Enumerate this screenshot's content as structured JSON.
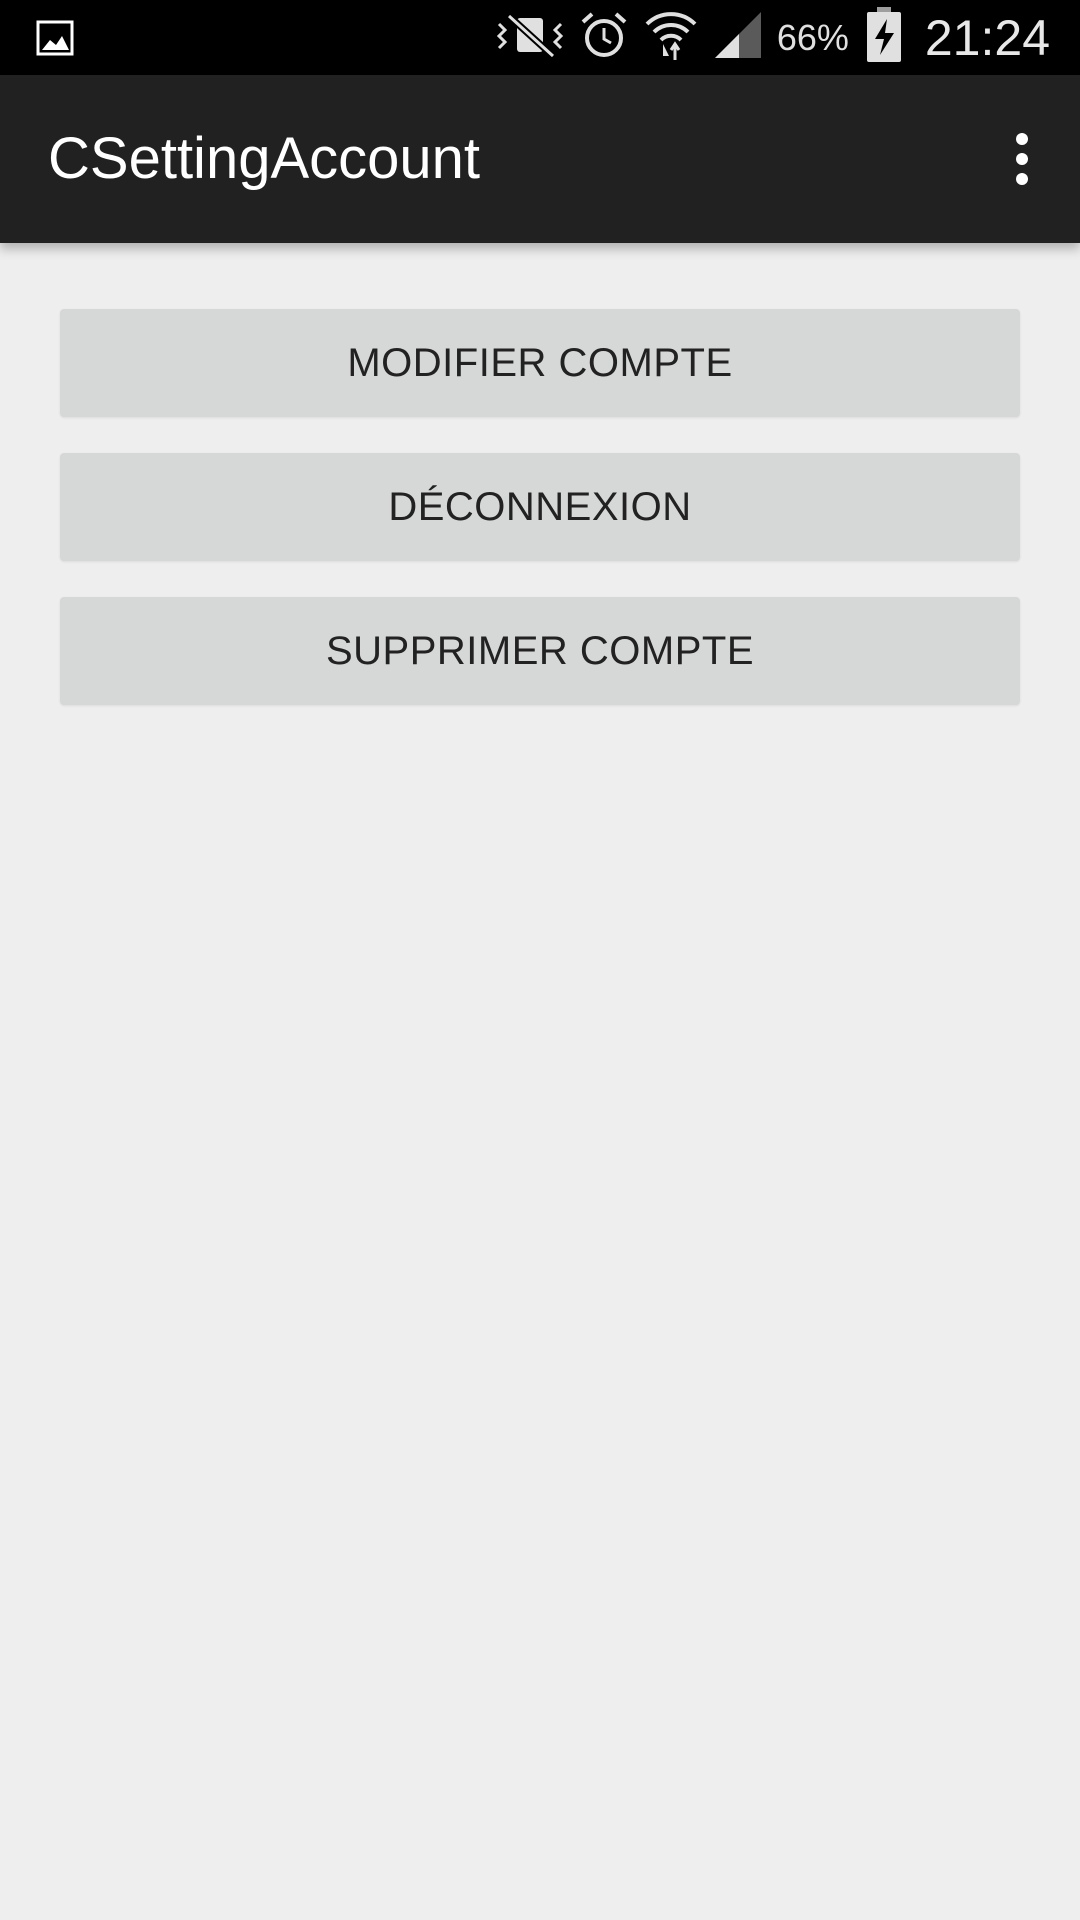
{
  "status_bar": {
    "left_icon": "image-notification-icon",
    "icons": [
      "vibrate-mute-icon",
      "alarm-icon",
      "wifi-icon",
      "cell-signal-icon"
    ],
    "battery_percent": "66%",
    "battery_icon": "battery-charging-icon",
    "time": "21:24"
  },
  "app_bar": {
    "title": "CSettingAccount",
    "overflow_icon": "overflow-menu-icon"
  },
  "buttons": [
    {
      "label": "MODIFIER COMPTE"
    },
    {
      "label": "DÉCONNEXION"
    },
    {
      "label": "SUPPRIMER COMPTE"
    }
  ],
  "colors": {
    "status_bar_bg": "#000000",
    "app_bar_bg": "#212121",
    "page_bg": "#eeeeee",
    "button_bg": "#d6d7d7",
    "button_text": "#222222"
  }
}
